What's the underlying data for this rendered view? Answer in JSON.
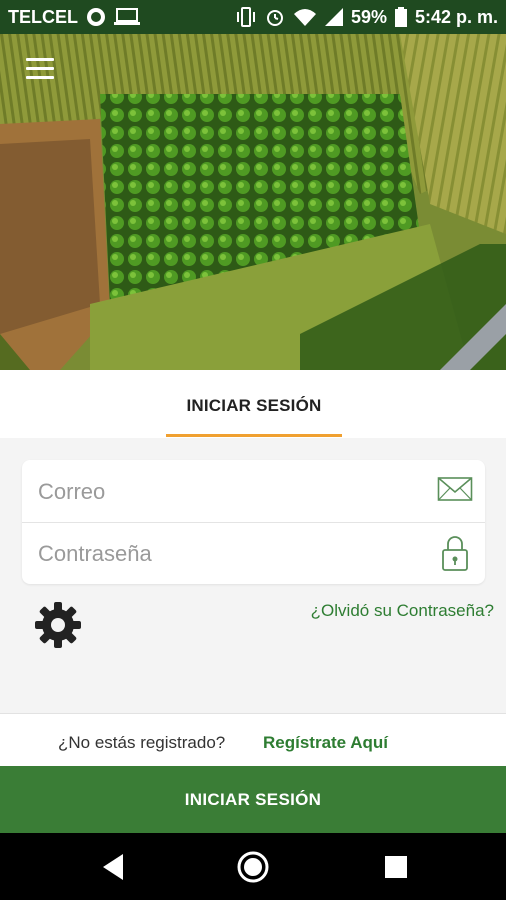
{
  "status_bar": {
    "carrier": "TELCEL",
    "battery": "59%",
    "time": "5:42 p. m."
  },
  "hero": {
    "image": "aerial-farm-field-photo"
  },
  "tabs": [
    {
      "label": "INICIAR SESIÓN",
      "active": true
    }
  ],
  "form": {
    "email_placeholder": "Correo",
    "password_placeholder": "Contraseña"
  },
  "forgot_password": "¿Olvidó su Contraseña?",
  "register": {
    "question": "¿No estás registrado?",
    "link": "Regístrate Aquí"
  },
  "login_button": "INICIAR SESIÓN",
  "icons": {
    "menu": "hamburger-menu-icon",
    "email": "envelope-icon",
    "password": "padlock-icon",
    "settings": "gear-icon",
    "nav_back": "back-triangle-icon",
    "nav_home": "home-circle-icon",
    "nav_recents": "recents-square-icon"
  },
  "colors": {
    "status_bar": "#1f4a20",
    "accent_green": "#2e7d32",
    "button_green": "#3a7d36",
    "tab_indicator": "#f0a030"
  }
}
